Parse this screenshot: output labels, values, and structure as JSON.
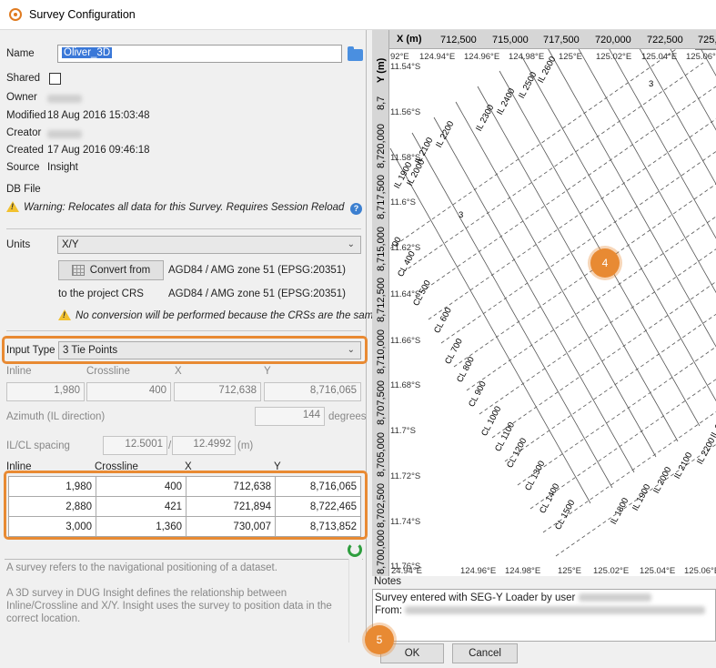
{
  "window": {
    "title": "Survey Configuration"
  },
  "fields": {
    "name_label": "Name",
    "name_value": "Oliver_3D",
    "shared_label": "Shared",
    "owner_label": "Owner",
    "modified_label": "Modified",
    "modified_value": "18 Aug 2016 15:03:48",
    "creator_label": "Creator",
    "created_label": "Created",
    "created_value": "17 Aug 2016 09:46:18",
    "source_label": "Source",
    "source_value": "Insight",
    "dbfile_label": "DB File",
    "dbfile_warning": "Warning: Relocates all data for this Survey. Requires Session Reload"
  },
  "units": {
    "label": "Units",
    "value": "X/Y",
    "convert_button": "Convert from",
    "from_crs": "AGD84 / AMG zone 51 (EPSG:20351)",
    "to_label": "to the project CRS",
    "to_crs": "AGD84 / AMG zone 51 (EPSG:20351)",
    "no_conversion": "No conversion will be performed because the CRSs are the same"
  },
  "input_type": {
    "label": "Input Type",
    "value": "3 Tie Points",
    "col_inline": "Inline",
    "col_crossline": "Crossline",
    "col_x": "X",
    "col_y": "Y",
    "ref_inline": "1,980",
    "ref_crossline": "400",
    "ref_x": "712,638",
    "ref_y": "8,716,065",
    "azimuth_label": "Azimuth (IL direction)",
    "azimuth_value": "144",
    "azimuth_unit": "degrees",
    "spacing_label": "IL/CL spacing",
    "spacing_il": "12.5001",
    "spacing_sep": "/",
    "spacing_cl": "12.4992",
    "spacing_unit": "(m)"
  },
  "tie_points": {
    "headers": [
      "Inline",
      "Crossline",
      "X",
      "Y"
    ],
    "rows": [
      [
        "1,980",
        "400",
        "712,638",
        "8,716,065"
      ],
      [
        "2,880",
        "421",
        "721,894",
        "8,722,465"
      ],
      [
        "3,000",
        "1,360",
        "730,007",
        "8,713,852"
      ]
    ]
  },
  "description": {
    "p1": "A survey refers to the navigational positioning of a dataset.",
    "p2": "A 3D survey in DUG Insight defines the relationship between Inline/Crossline and X/Y. Insight uses the survey to position data in the correct location."
  },
  "map": {
    "x_axis_title": "X (m)",
    "x_ticks": [
      "712,500",
      "715,000",
      "717,500",
      "720,000",
      "722,500",
      "725,"
    ],
    "y_axis_title": "Y (m)",
    "y_ticks": [
      "8,7",
      "8,720,000",
      "8,717,500",
      "8,715,000",
      "8,712,500",
      "8,710,000",
      "8,707,500",
      "8,705,000",
      "8,702,500",
      "8,700,000"
    ],
    "lon_top": [
      "92°E",
      "124.94°E",
      "124.96°E",
      "124.98°E",
      "125°E",
      "125.02°E",
      "125.04°E",
      "125.06°"
    ],
    "lon_bottom": [
      "24.94°E",
      "124.96°E",
      "124.98°E",
      "125°E",
      "125.02°E",
      "125.04°E",
      "125.06°E"
    ],
    "lat": [
      "11.54°S",
      "11.56°S",
      "11.58°S",
      "11.6°S",
      "11.62°S",
      "11.64°S",
      "11.66°S",
      "11.68°S",
      "11.7°S",
      "11.72°S",
      "11.74°S",
      "11.76°S"
    ],
    "inline_labels": [
      "IL 2600",
      "IL 2500",
      "IL 2400",
      "IL 2300",
      "IL 2200",
      "IL 2100",
      "IL 2000",
      "IL 1900",
      "IL 1800",
      "IL 1900",
      "IL 2000",
      "IL 2100",
      "IL 2200",
      "IL 2"
    ],
    "crossline_labels": [
      "00",
      "CL 400",
      "CL 500",
      "CL 600",
      "CL 700",
      "CL 800",
      "CL 900",
      "CL 1000",
      "CL 1100",
      "CL 1200",
      "CL 1300",
      "CL 1400",
      "CL 1500"
    ],
    "marks": [
      "3",
      "3"
    ]
  },
  "callouts": {
    "map": "4",
    "ok": "5"
  },
  "notes": {
    "label": "Notes",
    "line1": "Survey entered with SEG-Y Loader by user",
    "line2": "From:"
  },
  "buttons": {
    "ok": "OK",
    "cancel": "Cancel"
  },
  "colors": {
    "highlight": "#e88a33",
    "selection": "#3a78d8"
  }
}
